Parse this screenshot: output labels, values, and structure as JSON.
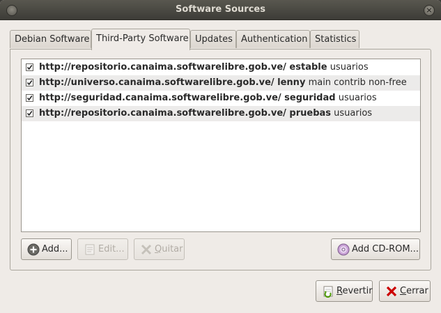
{
  "window": {
    "title": "Software Sources"
  },
  "tabs": [
    {
      "label": "Debian Software"
    },
    {
      "label": "Third-Party Software"
    },
    {
      "label": "Updates"
    },
    {
      "label": "Authentication"
    },
    {
      "label": "Statistics"
    }
  ],
  "sources": [
    {
      "checked": true,
      "url": "http://repositorio.canaima.softwarelibre.gob.ve/ estable",
      "components": "usuarios"
    },
    {
      "checked": true,
      "url": "http://universo.canaima.softwarelibre.gob.ve/ lenny",
      "components": "main contrib non-free"
    },
    {
      "checked": true,
      "url": "http://seguridad.canaima.softwarelibre.gob.ve/ seguridad",
      "components": "usuarios"
    },
    {
      "checked": true,
      "url": "http://repositorio.canaima.softwarelibre.gob.ve/ pruebas",
      "components": "usuarios"
    }
  ],
  "buttons": {
    "add": "Add...",
    "edit": "Edit...",
    "remove_mnemonic": "Q",
    "remove_rest": "uitar",
    "add_cdrom": "Add CD-ROM...",
    "revert_mnemonic": "R",
    "revert_rest": "evertir",
    "close_mnemonic": "C",
    "close_rest": "errar"
  }
}
